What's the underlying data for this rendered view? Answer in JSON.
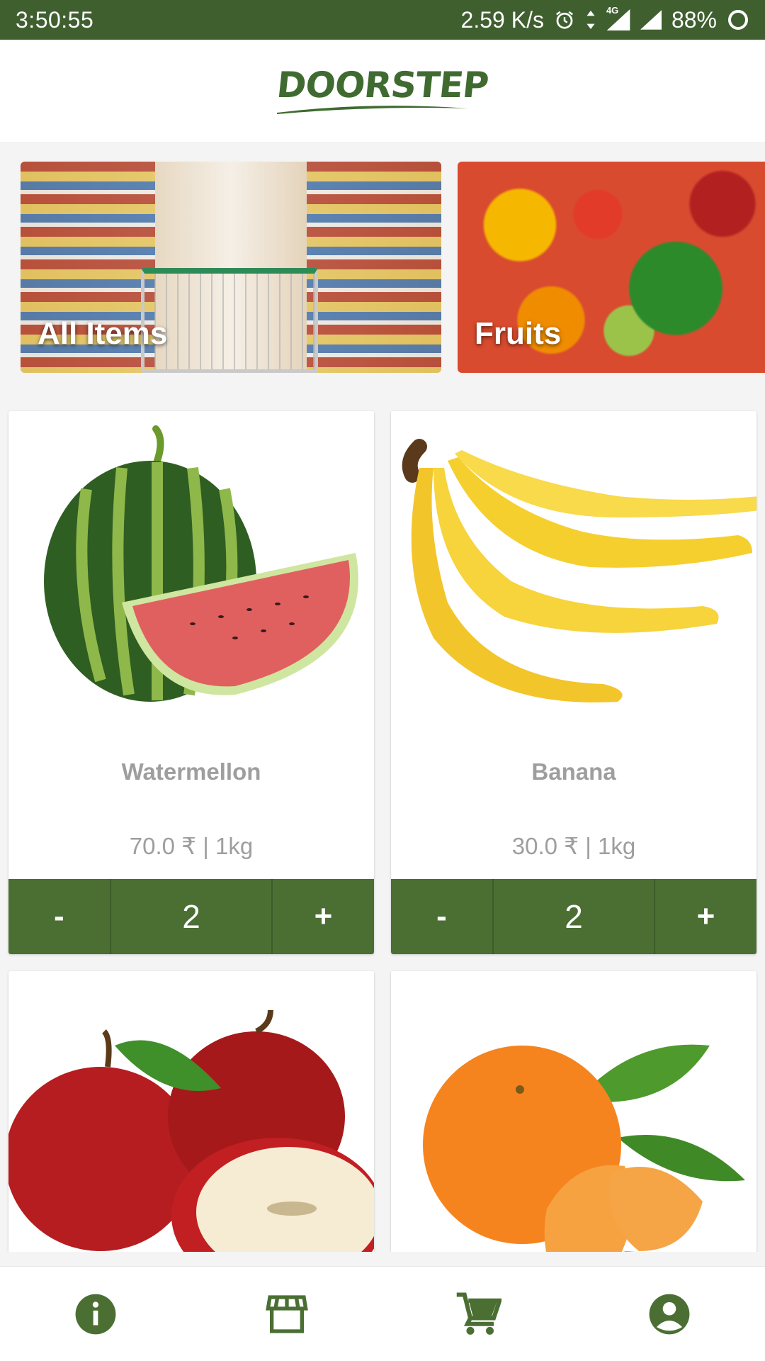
{
  "status_bar": {
    "time": "3:50:55",
    "network_speed": "2.59 K/s",
    "network_type": "4G",
    "battery": "88%",
    "icons": [
      "alarm-icon",
      "data-arrows-icon",
      "signal-icon",
      "signal-icon",
      "battery-icon"
    ]
  },
  "header": {
    "logo_text": "DOORSTEP"
  },
  "categories": [
    {
      "label": "All Items",
      "icon": "supermarket-aisle-image"
    },
    {
      "label": "Fruits",
      "icon": "fruits-collage-image"
    }
  ],
  "products": [
    {
      "name": "Watermellon",
      "price": "70.0 ₹  | 1kg",
      "quantity": "2",
      "minus_label": "-",
      "plus_label": "+",
      "image": "watermelon-image"
    },
    {
      "name": "Banana",
      "price": "30.0 ₹  | 1kg",
      "quantity": "2",
      "minus_label": "-",
      "plus_label": "+",
      "image": "banana-image"
    },
    {
      "name": "",
      "image": "apple-image"
    },
    {
      "name": "",
      "image": "orange-image"
    }
  ],
  "bottom_nav": [
    {
      "name": "info",
      "icon": "info-icon"
    },
    {
      "name": "store",
      "icon": "store-icon"
    },
    {
      "name": "cart",
      "icon": "cart-icon"
    },
    {
      "name": "account",
      "icon": "account-icon"
    }
  ],
  "colors": {
    "brand_green": "#4b6f33",
    "status_bar": "#3f5f2f",
    "text_muted": "#9e9e9e"
  }
}
